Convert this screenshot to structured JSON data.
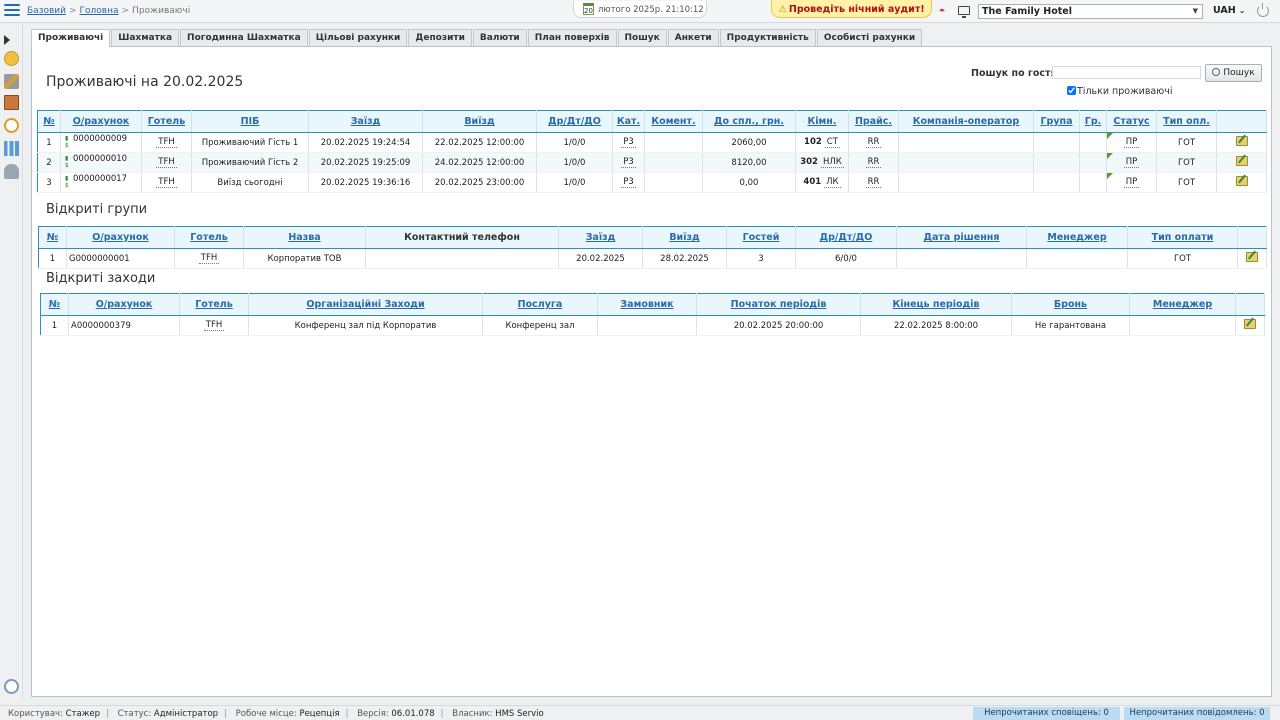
{
  "breadcrumb": {
    "root": "Базовий",
    "home": "Головна",
    "current": "Проживаючі"
  },
  "header": {
    "date_day": "20",
    "date_text": "лютого 2025р.  21:10:12",
    "audit_label": "Проведіть нічний аудит!",
    "hotel": "The Family Hotel",
    "currency": "UAH"
  },
  "tabs": [
    "Проживаючі",
    "Шахматка",
    "Погодинна Шахматка",
    "Цільові рахунки",
    "Депозити",
    "Валюти",
    "План поверхів",
    "Пошук",
    "Анкети",
    "Продуктивність",
    "Особисті рахунки"
  ],
  "main": {
    "title": "Проживаючі на 20.02.2025",
    "search_label": "Пошук по гостях",
    "search_placeholder": "",
    "search_button": "Пошук",
    "only_residents": "Тільки проживаючі"
  },
  "residents": {
    "headers": [
      "№",
      "О/рахунок",
      "Готель",
      "ПІБ",
      "Заїзд",
      "Виїзд",
      "Др/Дт/ДО",
      "Кат.",
      "Комент.",
      "До спл., грн.",
      "Кімн.",
      "Прайс.",
      "Компанія-оператор",
      "Група",
      "Гр.",
      "Статус",
      "Тип опл."
    ],
    "rows": [
      {
        "n": "1",
        "acc": "0000000009",
        "hotel": "TFH",
        "name": "Проживаючий Гість 1",
        "in": "20.02.2025 19:24:54",
        "out": "22.02.2025 12:00:00",
        "guests": "1/0/0",
        "cat": "Р3",
        "comment": "",
        "due": "2060,00",
        "room": "102",
        "room_type": "СТ",
        "price": "RR",
        "company": "",
        "group": "",
        "gr": "",
        "status": "ПР",
        "pay": "ГОТ"
      },
      {
        "n": "2",
        "acc": "0000000010",
        "hotel": "TFH",
        "name": "Проживаючий Гість 2",
        "in": "20.02.2025 19:25:09",
        "out": "24.02.2025 12:00:00",
        "guests": "1/0/0",
        "cat": "Р3",
        "comment": "",
        "due": "8120,00",
        "room": "302",
        "room_type": "НЛК",
        "price": "RR",
        "company": "",
        "group": "",
        "gr": "",
        "status": "ПР",
        "pay": "ГОТ"
      },
      {
        "n": "3",
        "acc": "0000000017",
        "hotel": "TFH",
        "name": "Виїзд сьогодні",
        "in": "20.02.2025 19:36:16",
        "out": "20.02.2025 23:00:00",
        "guests": "1/0/0",
        "cat": "Р3",
        "comment": "",
        "due": "0,00",
        "room": "401",
        "room_type": "ЛК",
        "price": "RR",
        "company": "",
        "group": "",
        "gr": "",
        "status": "ПР",
        "pay": "ГОТ"
      }
    ]
  },
  "groups": {
    "title": "Відкриті групи",
    "headers": [
      "№",
      "О/рахунок",
      "Готель",
      "Назва",
      "Контактний телефон",
      "Заїзд",
      "Виїзд",
      "Гостей",
      "Др/Дт/ДО",
      "Дата рішення",
      "Менеджер",
      "Тип оплати"
    ],
    "rows": [
      {
        "n": "1",
        "acc": "G0000000001",
        "hotel": "TFH",
        "name": "Корпоратив ТОВ",
        "phone": "",
        "in": "20.02.2025",
        "out": "28.02.2025",
        "guests": "3",
        "split": "6/0/0",
        "decision": "",
        "manager": "",
        "pay": "ГОТ"
      }
    ]
  },
  "events": {
    "title": "Відкриті заходи",
    "headers": [
      "№",
      "О/рахунок",
      "Готель",
      "Організаційні Заходи",
      "Послуга",
      "Замовник",
      "Початок періодів",
      "Кінець періодів",
      "Бронь",
      "Менеджер"
    ],
    "rows": [
      {
        "n": "1",
        "acc": "A0000000379",
        "hotel": "TFH",
        "name": "Конференц зал під Корпоратив",
        "service": "Конференц зал",
        "customer": "",
        "start": "20.02.2025 20:00:00",
        "end": "22.02.2025 8:00:00",
        "booking": "Не гарантована",
        "manager": ""
      }
    ]
  },
  "statusbar": {
    "user_label": "Користувач:",
    "user": "Стажер",
    "status_label": "Статус:",
    "status": "Адміністратор",
    "workplace_label": "Робоче місце:",
    "workplace": "Рецепція",
    "version_label": "Версія:",
    "version": "06.01.078",
    "owner_label": "Власник:",
    "owner": "HMS Servio",
    "unread_notifications": "Непрочитаних сповіщень: 0",
    "unread_messages": "Непрочитаних повідомлень: 0"
  }
}
